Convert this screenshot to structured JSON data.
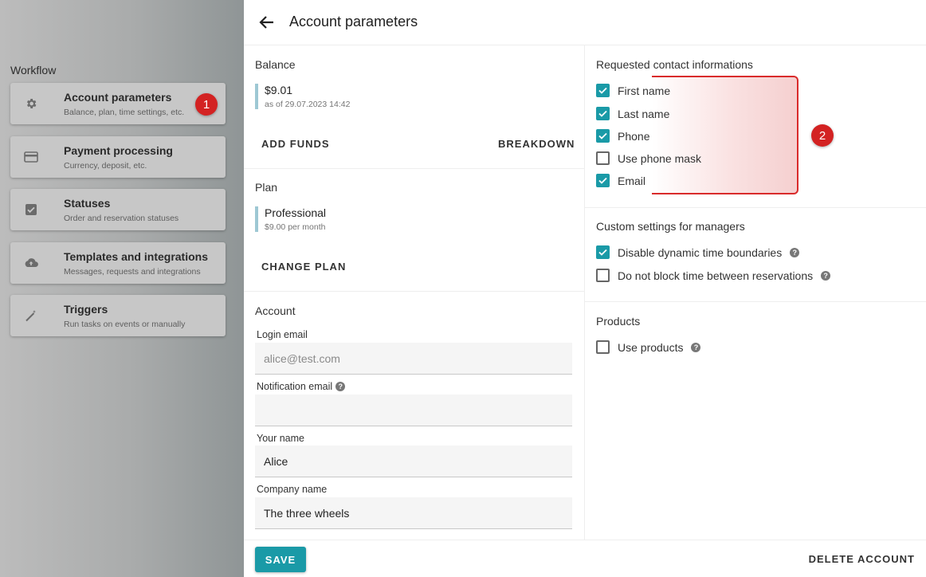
{
  "colors": {
    "accent": "#1a9aa7",
    "badge": "#d32222",
    "highlight_border": "#d92b2b"
  },
  "sidebar": {
    "heading": "Workflow",
    "items": [
      {
        "title": "Account parameters",
        "subtitle": "Balance, plan, time settings, etc.",
        "icon": "gear-icon"
      },
      {
        "title": "Payment processing",
        "subtitle": "Currency, deposit, etc.",
        "icon": "credit-card-icon"
      },
      {
        "title": "Statuses",
        "subtitle": "Order and reservation statuses",
        "icon": "checkbox-icon"
      },
      {
        "title": "Templates and integrations",
        "subtitle": "Messages, requests and integrations",
        "icon": "cloud-upload-icon"
      },
      {
        "title": "Triggers",
        "subtitle": "Run tasks on events or manually",
        "icon": "magic-wand-icon"
      }
    ]
  },
  "annotations": {
    "badge1": "1",
    "badge2": "2"
  },
  "header": {
    "title": "Account parameters",
    "back_icon": "arrow-left-icon"
  },
  "balance": {
    "title": "Balance",
    "amount": "$9.01",
    "as_of": "as of 29.07.2023 14:42",
    "add_funds": "ADD FUNDS",
    "breakdown": "BREAKDOWN"
  },
  "plan": {
    "title": "Plan",
    "name": "Professional",
    "price": "$9.00 per month",
    "change": "CHANGE PLAN"
  },
  "account": {
    "title": "Account",
    "login_email_label": "Login email",
    "login_email_value": "alice@test.com",
    "notification_email_label": "Notification email",
    "notification_email_value": "",
    "your_name_label": "Your name",
    "your_name_value": "Alice",
    "company_name_label": "Company name",
    "company_name_value": "The three wheels"
  },
  "contact": {
    "title": "Requested contact informations",
    "items": [
      {
        "label": "First name",
        "checked": true
      },
      {
        "label": "Last name",
        "checked": true
      },
      {
        "label": "Phone",
        "checked": true
      },
      {
        "label": "Use phone mask",
        "checked": false
      },
      {
        "label": "Email",
        "checked": true
      }
    ]
  },
  "managers": {
    "title": "Custom settings for managers",
    "items": [
      {
        "label": "Disable dynamic time boundaries",
        "checked": true
      },
      {
        "label": "Do not block time between reservations",
        "checked": false
      }
    ]
  },
  "products": {
    "title": "Products",
    "items": [
      {
        "label": "Use products",
        "checked": false
      }
    ]
  },
  "footer": {
    "save": "SAVE",
    "delete": "DELETE ACCOUNT"
  }
}
